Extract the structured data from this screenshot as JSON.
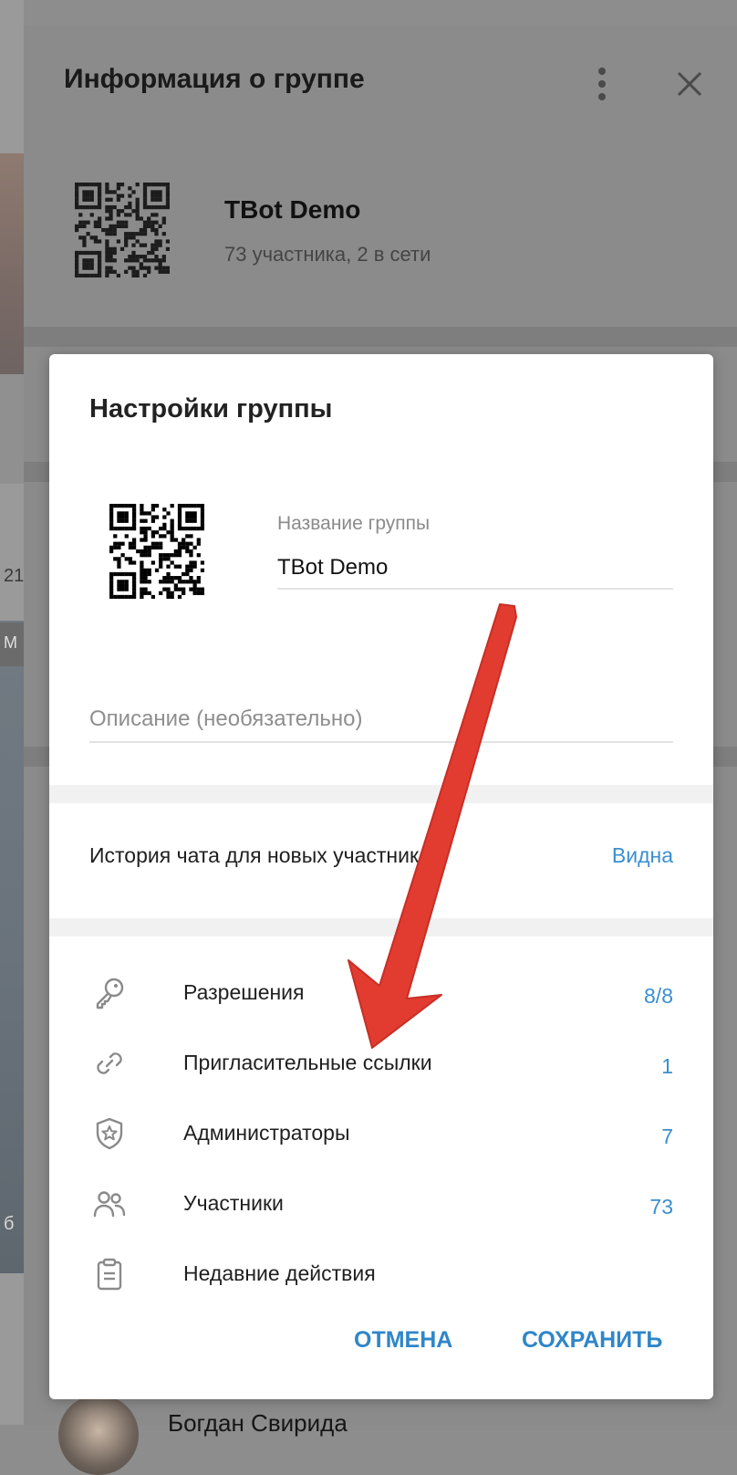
{
  "background": {
    "fragment_1": "21",
    "fragment_2": "М",
    "fragment_3": "б"
  },
  "info_panel": {
    "title": "Информация о группе",
    "group_name": "TBot Demo",
    "members_status": "73 участника, 2 в сети",
    "bottom_member_name": "Богдан Свирида"
  },
  "dialog": {
    "title": "Настройки группы",
    "name_field": {
      "label": "Название группы",
      "value": "TBot Demo"
    },
    "description_field": {
      "placeholder": "Описание (необязательно)",
      "value": ""
    },
    "history": {
      "label": "История чата для новых участников",
      "value": "Видна"
    },
    "menu": [
      {
        "label": "Разрешения",
        "value": "8/8",
        "icon": "key-icon"
      },
      {
        "label": "Пригласительные ссылки",
        "value": "1",
        "icon": "link-icon"
      },
      {
        "label": "Администраторы",
        "value": "7",
        "icon": "shield-star-icon"
      },
      {
        "label": "Участники",
        "value": "73",
        "icon": "users-icon"
      },
      {
        "label": "Недавние действия",
        "value": "",
        "icon": "clipboard-icon"
      }
    ],
    "cancel_label": "ОТМЕНА",
    "save_label": "СОХРАНИТЬ"
  },
  "colors": {
    "accent": "#3a8fd0",
    "annotation_arrow": "#e23b30",
    "overlay_panel": "#8b8b8b"
  }
}
